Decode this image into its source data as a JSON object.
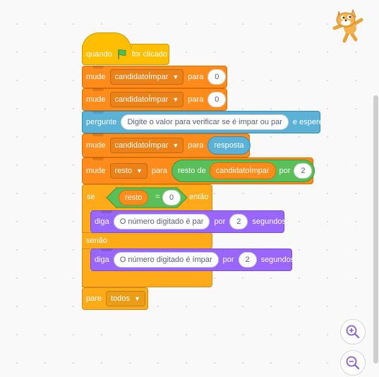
{
  "script": {
    "hat": {
      "label": "quando",
      "suffix": "for clicado"
    },
    "set1": {
      "label": "mude",
      "variable": "candidatoÍmpar",
      "to": "para",
      "value": "0"
    },
    "set2": {
      "label": "mude",
      "variable": "candidatoÍmpar",
      "to": "para",
      "value": "0"
    },
    "ask": {
      "label": "pergunte",
      "question": "Digite o valor para verificar se é impar ou par",
      "suffix": "e espere"
    },
    "set3": {
      "label": "mude",
      "variable": "candidatoÍmpar",
      "to": "para",
      "value": "resposta"
    },
    "set4": {
      "label": "mude",
      "variable": "resto",
      "to": "para",
      "op_label": "resto de",
      "op_var": "candidatoÍmpar",
      "op_by": "por",
      "op_value": "2"
    },
    "if": {
      "label": "se",
      "left": "resto",
      "op": "=",
      "right": "0",
      "then": "então",
      "else": "senão"
    },
    "say1": {
      "label": "diga",
      "text": "O número digitado é par",
      "by": "por",
      "secs": "2",
      "unit": "segundos"
    },
    "say2": {
      "label": "diga",
      "text": "O número digitado é ímpar",
      "by": "por",
      "secs": "2",
      "unit": "segundos"
    },
    "stop": {
      "label": "pare",
      "option": "todos"
    }
  },
  "icons": {
    "flag": "green-flag-icon",
    "zoom_in": "zoom-in-icon",
    "zoom_out": "zoom-out-icon",
    "sprite": "scratch-cat-icon"
  },
  "colors": {
    "events": "#ffbf00",
    "variables": "#ff8c1a",
    "sensing": "#5cb1d6",
    "looks": "#9966ff",
    "operators": "#59c059",
    "control": "#ffab19"
  }
}
